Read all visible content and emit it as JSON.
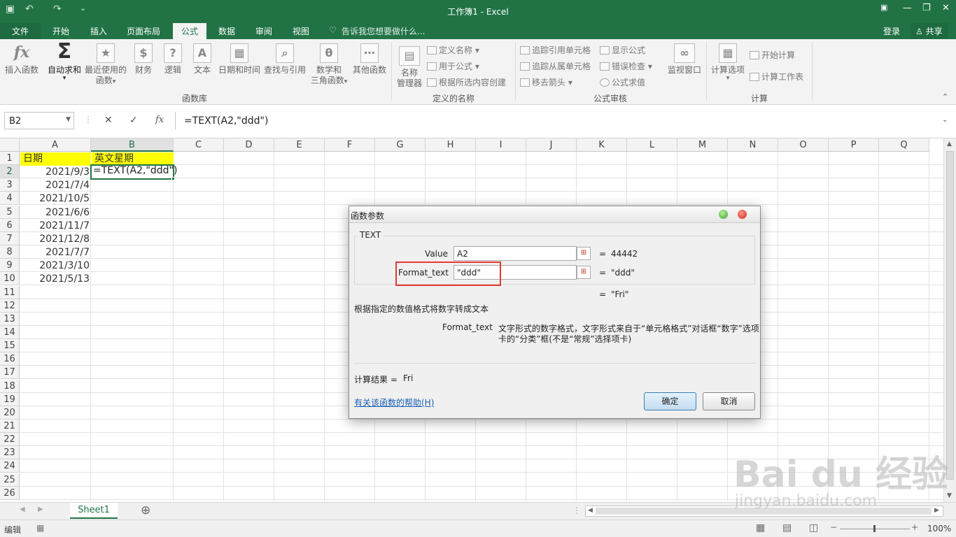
{
  "title_bar": {
    "title": "工作簿1 - Excel",
    "qa_save": "▣",
    "qa_undo": "↶",
    "qa_redo": "↷",
    "qa_more": "⌄"
  },
  "tabs": [
    "文件",
    "开始",
    "插入",
    "页面布局",
    "公式",
    "数据",
    "审阅",
    "视图"
  ],
  "tell_me": "告诉我您想要做什么...",
  "account": {
    "login": "登录",
    "share": "共享"
  },
  "ribbon": {
    "insert_function": "插入函数",
    "autosum": "自动求和",
    "recent_l1": "最近使用的",
    "recent_l2": "函数",
    "finance": "财务",
    "logic": "逻辑",
    "text": "文本",
    "datetime": "日期和时间",
    "lookup": "查找与引用",
    "math_l1": "数学和",
    "math_l2": "三角函数",
    "other": "其他函数",
    "group_library": "函数库",
    "name_mgr_l1": "名称",
    "name_mgr_l2": "管理器",
    "define_name": "定义名称",
    "use_in_formula": "用于公式",
    "create_from_sel": "根据所选内容创建",
    "group_names": "定义的名称",
    "trace_precedents": "追踪引用单元格",
    "trace_dependents": "追踪从属单元格",
    "remove_arrows": "移去箭头",
    "show_formulas": "显示公式",
    "error_check": "错误检查",
    "evaluate": "公式求值",
    "group_audit": "公式审核",
    "watch_window": "监视窗口",
    "calc_options": "计算选项",
    "calc_now": "开始计算",
    "calc_sheet": "计算工作表",
    "group_calc": "计算"
  },
  "formula_bar": {
    "name_box": "B2",
    "cancel": "✕",
    "enter": "✓",
    "fx": "fx",
    "formula": "=TEXT(A2,\"ddd\")"
  },
  "columns": [
    "A",
    "B",
    "C",
    "D",
    "E",
    "F",
    "G",
    "H",
    "I",
    "J",
    "K",
    "L",
    "M",
    "N",
    "O",
    "P",
    "Q"
  ],
  "rows": [
    "1",
    "2",
    "3",
    "4",
    "5",
    "6",
    "7",
    "8",
    "9",
    "10",
    "11",
    "12",
    "13",
    "14",
    "15",
    "16",
    "17",
    "18",
    "19",
    "20",
    "21",
    "22",
    "23",
    "24",
    "25",
    "26"
  ],
  "cells": {
    "a1": "日期",
    "b1": "英文星期",
    "b2": "=TEXT(A2,\"ddd\")",
    "dates": [
      "2021/9/3",
      "2021/7/4",
      "2021/10/5",
      "2021/6/6",
      "2021/11/7",
      "2021/12/8",
      "2021/7/7",
      "2021/3/10",
      "2021/5/13"
    ]
  },
  "sheet": {
    "tab": "Sheet1",
    "add": "⊕"
  },
  "status": {
    "mode": "编辑",
    "zoom": "100%"
  },
  "dialog": {
    "title": "函数参数",
    "func_name": "TEXT",
    "arg1_label": "Value",
    "arg1_value": "A2",
    "arg1_result": "44442",
    "arg2_label": "Format_text",
    "arg2_value": "\"ddd\"",
    "arg2_result": "\"ddd\"",
    "equals": "=",
    "func_result": "\"Fri\"",
    "description": "根据指定的数值格式将数字转成文本",
    "param_name": "Format_text",
    "param_desc_l1": "文字形式的数字格式，文字形式来自于“单元格格式”对话框“数字”选项",
    "param_desc_l2": "卡的“分类”框(不是“常规”选择项卡)",
    "calc_result_label": "计算结果 =",
    "calc_result_value": "Fri",
    "help_link": "有关该函数的帮助(H)",
    "ok": "确定",
    "cancel": "取消"
  },
  "watermark": {
    "l1": "Bai du 经验",
    "l2": "jingyan.baidu.com"
  },
  "colors": {
    "excel_green": "#217346",
    "highlight_yellow": "#ffff00",
    "callout_red": "#e53935"
  }
}
